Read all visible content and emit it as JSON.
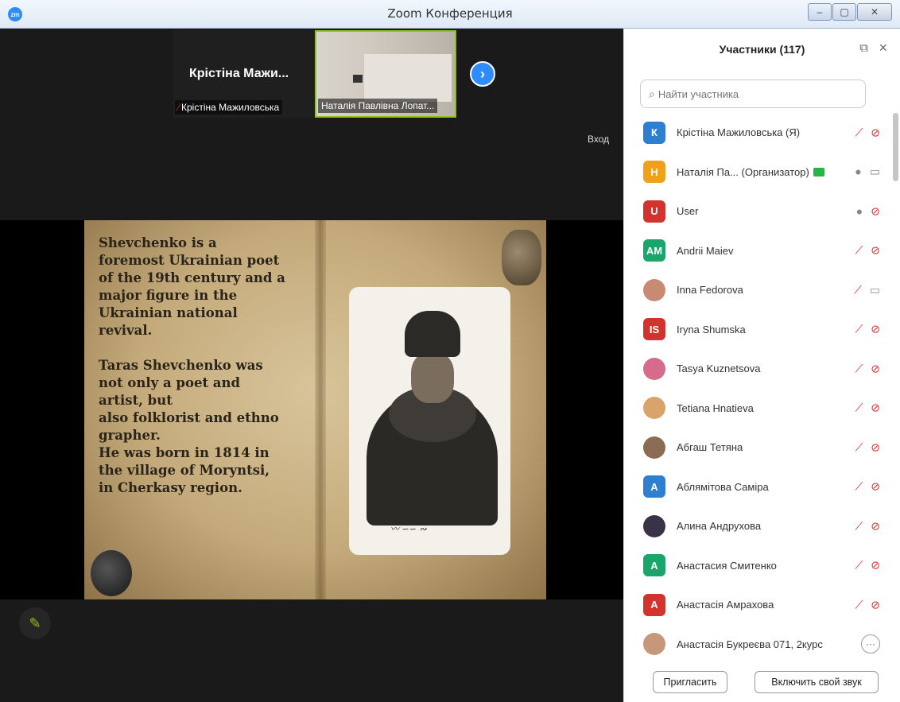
{
  "window": {
    "title": "Zoom Конференция",
    "logo_text": "zm",
    "minimize": "–",
    "maximize": "▢",
    "close": "✕"
  },
  "thumbnails": [
    {
      "display_name": "Крістіна Мажи...",
      "label": "Крістіна Мажиловська",
      "muted": true
    },
    {
      "label": "Наталія Павлівна Лопат..."
    }
  ],
  "next_icon": "›",
  "enter_label": "Вход",
  "slide": {
    "text": "Shevchenko is a\nforemost Ukrainian poet\nof the 19th century and a\nmajor figure in the\nUkrainian national\nrevival.\n\nTaras Shevchenko was\nnot only a poet and\nartist, but\nalso  folklorist and ethno\ngrapher.\nHe was born in 1814 in\nthe village of Moryntsi,\nin Cherkasy region."
  },
  "annotate_icon": "✎",
  "panel": {
    "title": "Участники (117)",
    "popout_icon": "⧉",
    "close_icon": "×",
    "search_placeholder": "Найти участника",
    "participants": [
      {
        "initials": "К",
        "name": "Крістіна Мажиловська (Я)",
        "color": "#2f7fd1",
        "mic": "off",
        "cam": "off"
      },
      {
        "initials": "Н",
        "name": "Наталія Па...  (Организатор)",
        "color": "#f0a01a",
        "mic": "on",
        "cam": "on",
        "sharing": true
      },
      {
        "initials": "U",
        "name": "User",
        "color": "#d0342c",
        "mic": "on",
        "cam": "off"
      },
      {
        "initials": "AM",
        "name": "Andrii Maiev",
        "color": "#1aa56a",
        "mic": "off",
        "cam": "off"
      },
      {
        "initials": "",
        "name": "Inna Fedorova",
        "color": "#c98a73",
        "photo": true,
        "mic": "off",
        "cam": "on"
      },
      {
        "initials": "IS",
        "name": "Iryna Shumska",
        "color": "#d0342c",
        "mic": "off",
        "cam": "off"
      },
      {
        "initials": "",
        "name": "Tasya Kuznetsova",
        "color": "#d76b8b",
        "photo": true,
        "mic": "off",
        "cam": "off"
      },
      {
        "initials": "",
        "name": "Tetiana Hnatieva",
        "color": "#d9a46b",
        "photo": true,
        "mic": "off",
        "cam": "off"
      },
      {
        "initials": "",
        "name": "Абгаш Тетяна",
        "color": "#8a6c55",
        "photo": true,
        "mic": "off",
        "cam": "off"
      },
      {
        "initials": "А",
        "name": "Аблямітова Саміра",
        "color": "#2f7fd1",
        "mic": "off",
        "cam": "off"
      },
      {
        "initials": "",
        "name": "Алина Андрухова",
        "color": "#3a3348",
        "photo": true,
        "mic": "off",
        "cam": "off"
      },
      {
        "initials": "А",
        "name": "Анастасия Смитенко",
        "color": "#1aa56a",
        "mic": "off",
        "cam": "off"
      },
      {
        "initials": "А",
        "name": "Анастасія Амрахова",
        "color": "#d0342c",
        "mic": "off",
        "cam": "off"
      },
      {
        "initials": "",
        "name": "Анастасія Букреєва 071,  2курс",
        "color": "#c7977a",
        "photo": true,
        "more": true
      }
    ],
    "invite_label": "Пригласить",
    "unmute_label": "Включить свой звук"
  },
  "icons": {
    "mic_off": "🎙",
    "cam_off": "✕",
    "more": "···"
  }
}
